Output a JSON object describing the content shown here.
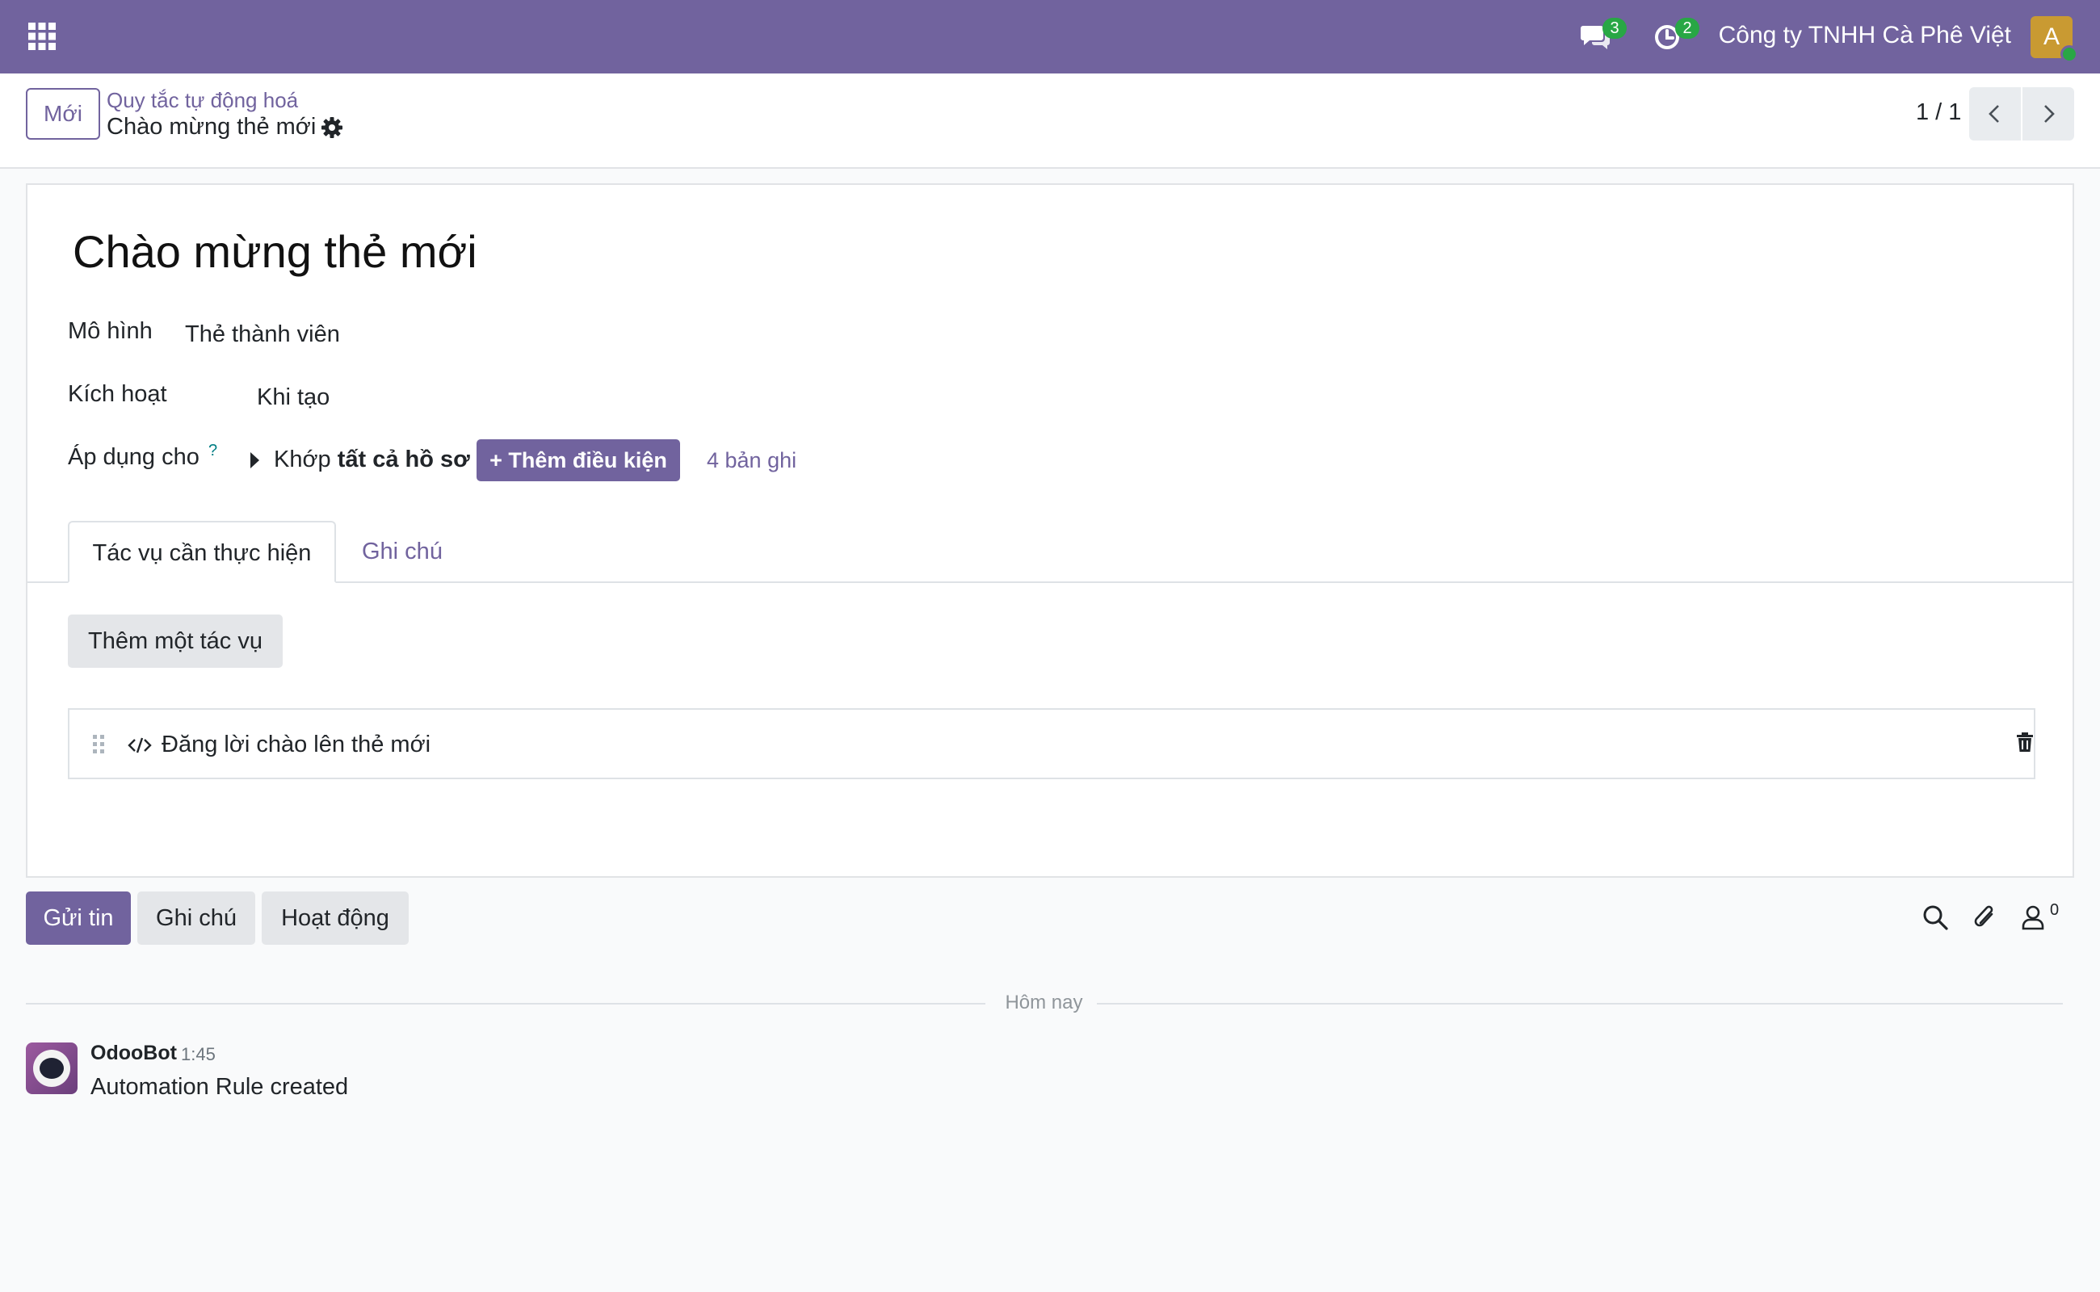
{
  "colors": {
    "brand": "#71639e",
    "badge": "#28a745",
    "avatar": "#c99a32"
  },
  "navbar": {
    "apps_icon": "grid-icon",
    "messages_badge": "3",
    "activities_badge": "2",
    "company": "Công ty TNHH Cà Phê Việt",
    "user_initial": "A"
  },
  "control_panel": {
    "new_label": "Mới",
    "breadcrumb_parent": "Quy tắc tự động hoá",
    "breadcrumb_current": "Chào mừng thẻ mới",
    "pager_value": "1 / 1"
  },
  "form": {
    "title": "Chào mừng thẻ mới",
    "model_label": "Mô hình",
    "model_value": "Thẻ thành viên",
    "trigger_label": "Kích hoạt",
    "trigger_value": "Khi tạo",
    "apply_label": "Áp dụng cho",
    "help_marker": "?",
    "domain_prefix": "Khớp",
    "domain_bold": "tất cả hồ sơ",
    "add_condition": "+ Thêm điều kiện",
    "records_count": "4 bản ghi"
  },
  "tabs": [
    {
      "label": "Tác vụ cần thực hiện",
      "active": true
    },
    {
      "label": "Ghi chú",
      "active": false
    }
  ],
  "actions": {
    "add_label": "Thêm một tác vụ",
    "items": [
      {
        "label": "Đăng lời chào lên thẻ mới",
        "icon": "code-icon"
      }
    ]
  },
  "chatter": {
    "send_label": "Gửi tin",
    "note_label": "Ghi chú",
    "activity_label": "Hoạt động",
    "follower_count": "0",
    "date_separator": "Hôm nay",
    "messages": [
      {
        "author": "OdooBot",
        "time": "1:45",
        "body": "Automation Rule created"
      }
    ]
  }
}
